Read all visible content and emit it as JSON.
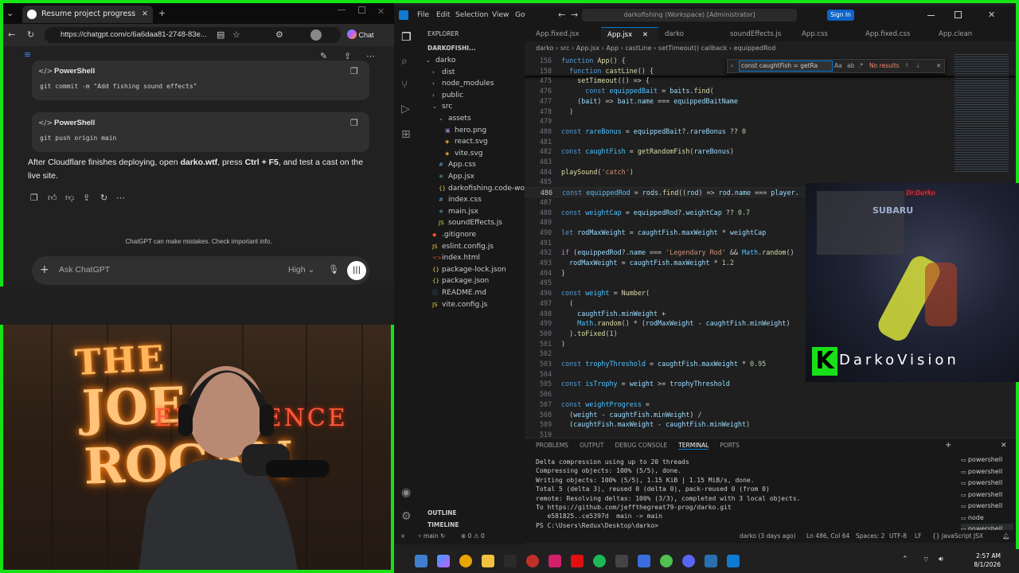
{
  "browser": {
    "tab_title": "Resume project progress",
    "url": "https://chatgpt.com/c/6a6daa81-2748-83e...",
    "chat_label": "Chat",
    "cards": [
      {
        "lang": "PowerShell",
        "code": "git commit -m \"Add fishing sound effects\""
      },
      {
        "lang": "PowerShell",
        "code": "git push origin main"
      }
    ],
    "message_pre": "After Cloudflare finishes deploying, open ",
    "message_bold1": "darko.wtf",
    "message_mid": ", press ",
    "message_bold2": "Ctrl + F5",
    "message_post": ", and test a cast on the",
    "message_line2": "live site.",
    "disclaimer": "ChatGPT can make mistakes. Check important info.",
    "input_placeholder": "Ask ChatGPT",
    "model_select": "High"
  },
  "overlay": {
    "sign_line1": "THE",
    "sign_line2": "JOE ROGAN",
    "sign_line3": "EXPERIENCE",
    "cam_logo_letter": "K",
    "cam_logo_text": "DarkoVision",
    "cam_sign": "Dr.Darko",
    "cam_plate": "SUBARU"
  },
  "vscode": {
    "menu": [
      "File",
      "Edit",
      "Selection",
      "View",
      "Go"
    ],
    "search_title": "darkofishing (Workspace) [Administrator]",
    "sign_in": "Sign In",
    "explorer_label": "EXPLORER",
    "workspace": "DARKOFISHI...",
    "tree": [
      {
        "label": "darko",
        "depth": 0,
        "kind": "folder-open"
      },
      {
        "label": "dist",
        "depth": 1,
        "kind": "folder"
      },
      {
        "label": "node_modules",
        "depth": 1,
        "kind": "folder"
      },
      {
        "label": "public",
        "depth": 1,
        "kind": "folder"
      },
      {
        "label": "src",
        "depth": 1,
        "kind": "folder-open"
      },
      {
        "label": "assets",
        "depth": 2,
        "kind": "folder-open"
      },
      {
        "label": "hero.png",
        "depth": 3,
        "kind": "png"
      },
      {
        "label": "react.svg",
        "depth": 3,
        "kind": "svg"
      },
      {
        "label": "vite.svg",
        "depth": 3,
        "kind": "svg"
      },
      {
        "label": "App.css",
        "depth": 2,
        "kind": "css"
      },
      {
        "label": "App.jsx",
        "depth": 2,
        "kind": "jsx"
      },
      {
        "label": "darkofishing.code-worksp...",
        "depth": 2,
        "kind": "json"
      },
      {
        "label": "index.css",
        "depth": 2,
        "kind": "css"
      },
      {
        "label": "main.jsx",
        "depth": 2,
        "kind": "jsx"
      },
      {
        "label": "soundEffects.js",
        "depth": 2,
        "kind": "js"
      },
      {
        "label": ".gitignore",
        "depth": 1,
        "kind": "git"
      },
      {
        "label": "eslint.config.js",
        "depth": 1,
        "kind": "js"
      },
      {
        "label": "index.html",
        "depth": 1,
        "kind": "html"
      },
      {
        "label": "package-lock.json",
        "depth": 1,
        "kind": "json"
      },
      {
        "label": "package.json",
        "depth": 1,
        "kind": "json"
      },
      {
        "label": "README.md",
        "depth": 1,
        "kind": "md"
      },
      {
        "label": "vite.config.js",
        "depth": 1,
        "kind": "js"
      }
    ],
    "outline": "OUTLINE",
    "timeline": "TIMELINE",
    "tabs": [
      {
        "label": "App.fixed.jsx",
        "active": false
      },
      {
        "label": "App.jsx",
        "active": true
      },
      {
        "label": "darko",
        "active": false
      },
      {
        "label": "soundEffects.js",
        "active": false
      },
      {
        "label": "App.css",
        "active": false
      },
      {
        "label": "App.fixed.css",
        "active": false
      },
      {
        "label": "App.clean",
        "active": false
      }
    ],
    "breadcrumb": [
      "darko",
      "src",
      "App.jsx",
      "App",
      "castLine",
      "setTimeout() callback",
      "equippedRod"
    ],
    "find_value": "const caughtFish = getRa",
    "find_result": "No results",
    "sticky": [
      {
        "n": "156",
        "html": "<span class='k'>function</span> <span class='f'>App</span>() {"
      },
      {
        "n": "158",
        "html": "  <span class='k'>function</span> <span class='f'>castLine</span>() {"
      }
    ],
    "code": [
      {
        "n": "475",
        "html": "    <span class='f'>setTimeout</span>(() => {"
      },
      {
        "n": "476",
        "html": "      <span class='k'>const</span> <span class='c'>equippedBait</span> = <span class='v'>baits</span>.<span class='f'>find</span>("
      },
      {
        "n": "477",
        "html": "    (<span class='v'>bait</span>) => <span class='v'>bait</span>.<span class='v'>name</span> === <span class='v'>equippedBaitName</span>"
      },
      {
        "n": "478",
        "html": "  )"
      },
      {
        "n": "479",
        "html": ""
      },
      {
        "n": "480",
        "html": "<span class='k'>const</span> <span class='c'>rareBonus</span> = <span class='v'>equippedBait</span>?.<span class='v'>rareBonus</span> ?? <span class='n'>0</span>"
      },
      {
        "n": "481",
        "html": ""
      },
      {
        "n": "482",
        "html": "<span class='k'>const</span> <span class='c'>caughtFish</span> = <span class='f'>getRandomFish</span>(<span class='v'>rareBonus</span>)"
      },
      {
        "n": "483",
        "html": ""
      },
      {
        "n": "484",
        "html": "<span class='f'>playSound</span>(<span class='s'>'catch'</span>)"
      },
      {
        "n": "485",
        "html": ""
      },
      {
        "n": "486",
        "html": "<span class='k'>const</span> <span class='c'>equippedRod</span> = <span class='v'>rods</span>.<span class='f'>find</span>((<span class='v'>rod</span>) => <span class='v'>rod</span>.<span class='v'>name</span> === <span class='v'>player</span>."
      },
      {
        "n": "487",
        "html": ""
      },
      {
        "n": "488",
        "html": "<span class='k'>const</span> <span class='c'>weightCap</span> = <span class='v'>equippedRod</span>?.<span class='v'>weightCap</span> ?? <span class='n'>0.7</span>"
      },
      {
        "n": "489",
        "html": ""
      },
      {
        "n": "490",
        "html": "<span class='k'>let</span> <span class='v'>rodMaxWeight</span> = <span class='v'>caughtFish</span>.<span class='v'>maxWeight</span> * <span class='v'>weightCap</span>"
      },
      {
        "n": "491",
        "html": ""
      },
      {
        "n": "492",
        "html": "<span class='p'>if</span> (<span class='v'>equippedRod</span>?.<span class='v'>name</span> === <span class='s'>'Legendary Rod'</span> && <span class='c'>Math</span>.<span class='f'>random</span>()"
      },
      {
        "n": "493",
        "html": "  <span class='v'>rodMaxWeight</span> = <span class='v'>caughtFish</span>.<span class='v'>maxWeight</span> * <span class='n'>1.2</span>"
      },
      {
        "n": "494",
        "html": "}"
      },
      {
        "n": "495",
        "html": ""
      },
      {
        "n": "496",
        "html": "<span class='k'>const</span> <span class='c'>weight</span> = <span class='f'>Number</span>("
      },
      {
        "n": "497",
        "html": "  ("
      },
      {
        "n": "498",
        "html": "    <span class='v'>caughtFish</span>.<span class='v'>minWeight</span> +"
      },
      {
        "n": "499",
        "html": "    <span class='c'>Math</span>.<span class='f'>random</span>() * (<span class='v'>rodMaxWeight</span> - <span class='v'>caughtFish</span>.<span class='v'>minWeight</span>)"
      },
      {
        "n": "500",
        "html": "  ).<span class='f'>toFixed</span>(<span class='n'>1</span>)"
      },
      {
        "n": "501",
        "html": ")"
      },
      {
        "n": "502",
        "html": ""
      },
      {
        "n": "503",
        "html": "<span class='k'>const</span> <span class='c'>trophyThreshold</span> = <span class='v'>caughtFish</span>.<span class='v'>maxWeight</span> * <span class='n'>0.95</span>"
      },
      {
        "n": "504",
        "html": ""
      },
      {
        "n": "505",
        "html": "<span class='k'>const</span> <span class='c'>isTrophy</span> = <span class='v'>weight</span> >= <span class='v'>trophyThreshold</span>"
      },
      {
        "n": "506",
        "html": ""
      },
      {
        "n": "507",
        "html": "<span class='k'>const</span> <span class='c'>weightProgress</span> ="
      },
      {
        "n": "508",
        "html": "  (<span class='v'>weight</span> - <span class='v'>caughtFish</span>.<span class='v'>minWeight</span>) /"
      },
      {
        "n": "509",
        "html": "  (<span class='v'>caughtFish</span>.<span class='v'>maxWeight</span> - <span class='v'>caughtFish</span>.<span class='v'>minWeight</span>)"
      },
      {
        "n": "510",
        "html": ""
      }
    ],
    "panel_tabs": [
      "PROBLEMS",
      "OUTPUT",
      "DEBUG CONSOLE",
      "TERMINAL",
      "PORTS"
    ],
    "terminal": [
      "Delta compression using up to 20 threads",
      "Compressing objects: 100% (5/5), done.",
      "Writing objects: 100% (5/5), 1.15 KiB | 1.15 MiB/s, done.",
      "Total 5 (delta 3), reused 0 (delta 0), pack-reused 0 (from 0)",
      "remote: Resolving deltas: 100% (3/3), completed with 3 local objects.",
      "To https://github.com/jeffthegreat79-prog/darko.git",
      "   e581825..ce5397d  main -> main",
      "PS C:\\Users\\Redux\\Desktop\\darko> "
    ],
    "shells": [
      "powershell",
      "powershell",
      "powershell",
      "powershell",
      "powershell",
      "node",
      "powershell"
    ],
    "status_left": [
      "main",
      "0",
      "0"
    ],
    "status_right": [
      "darko (3 days ago)",
      "Ln 486, Col 64",
      "Spaces: 2",
      "UTF-8",
      "LF",
      "{} JavaScript JSX"
    ]
  },
  "taskbar": {
    "time": "2:57 AM",
    "date": "8/1/2026"
  },
  "colors": {
    "frame": "#16e316",
    "accent": "#0078d4",
    "signin": "#0e63c8"
  }
}
